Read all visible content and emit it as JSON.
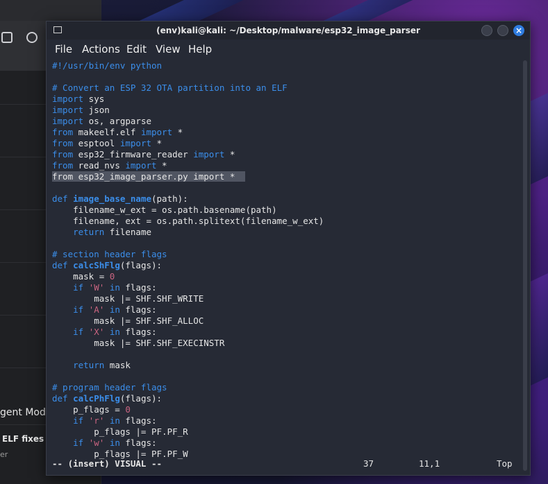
{
  "window": {
    "title": "(env)kali@kali: ~/Desktop/malware/esp32_image_parser"
  },
  "menu": [
    "File",
    "Actions",
    "Edit",
    "View",
    "Help"
  ],
  "bg_app": {
    "mode_label": "gent Mode",
    "item_title": "ELF fixes",
    "item_sub": "er"
  },
  "code": [
    [
      {
        "t": "#!/usr/bin/env python",
        "c": "cm"
      }
    ],
    [],
    [
      {
        "t": "# Convert an ESP 32 OTA partition into an ELF",
        "c": "cm"
      }
    ],
    [
      {
        "t": "import",
        "c": "kw"
      },
      {
        "t": " sys",
        "c": ""
      }
    ],
    [
      {
        "t": "import",
        "c": "kw"
      },
      {
        "t": " json",
        "c": ""
      }
    ],
    [
      {
        "t": "import",
        "c": "kw"
      },
      {
        "t": " os, argparse",
        "c": ""
      }
    ],
    [
      {
        "t": "from",
        "c": "kw"
      },
      {
        "t": " makeelf.elf ",
        "c": ""
      },
      {
        "t": "import",
        "c": "kw"
      },
      {
        "t": " *",
        "c": ""
      }
    ],
    [
      {
        "t": "from",
        "c": "kw"
      },
      {
        "t": " esptool ",
        "c": ""
      },
      {
        "t": "import",
        "c": "kw"
      },
      {
        "t": " *",
        "c": ""
      }
    ],
    [
      {
        "t": "from",
        "c": "kw"
      },
      {
        "t": " esp32_firmware_reader ",
        "c": ""
      },
      {
        "t": "import",
        "c": "kw"
      },
      {
        "t": " *",
        "c": ""
      }
    ],
    [
      {
        "t": "from",
        "c": "kw"
      },
      {
        "t": " read_nvs ",
        "c": ""
      },
      {
        "t": "import",
        "c": "kw"
      },
      {
        "t": " *",
        "c": ""
      }
    ],
    [
      {
        "t": "from esp32_image_parser.py import *  ",
        "c": "hl"
      }
    ],
    [],
    [
      {
        "t": "def",
        "c": "kw"
      },
      {
        "t": " ",
        "c": ""
      },
      {
        "t": "image_base_name",
        "c": "fn"
      },
      {
        "t": "(path):",
        "c": ""
      }
    ],
    [
      {
        "t": "    filename_w_ext = os.path.basename(path)",
        "c": ""
      }
    ],
    [
      {
        "t": "    filename, ext = os.path.splitext(filename_w_ext)",
        "c": ""
      }
    ],
    [
      {
        "t": "    ",
        "c": ""
      },
      {
        "t": "return",
        "c": "kw"
      },
      {
        "t": " filename",
        "c": ""
      }
    ],
    [],
    [
      {
        "t": "# section header flags",
        "c": "cm"
      }
    ],
    [
      {
        "t": "def",
        "c": "kw"
      },
      {
        "t": " ",
        "c": ""
      },
      {
        "t": "calcShFlg",
        "c": "fn"
      },
      {
        "t": "(flags):",
        "c": ""
      }
    ],
    [
      {
        "t": "    mask = ",
        "c": ""
      },
      {
        "t": "0",
        "c": "st"
      }
    ],
    [
      {
        "t": "    ",
        "c": ""
      },
      {
        "t": "if",
        "c": "kw"
      },
      {
        "t": " ",
        "c": ""
      },
      {
        "t": "'W'",
        "c": "st"
      },
      {
        "t": " ",
        "c": ""
      },
      {
        "t": "in",
        "c": "kw"
      },
      {
        "t": " flags:",
        "c": ""
      }
    ],
    [
      {
        "t": "        mask |= SHF.SHF_WRITE",
        "c": ""
      }
    ],
    [
      {
        "t": "    ",
        "c": ""
      },
      {
        "t": "if",
        "c": "kw"
      },
      {
        "t": " ",
        "c": ""
      },
      {
        "t": "'A'",
        "c": "st"
      },
      {
        "t": " ",
        "c": ""
      },
      {
        "t": "in",
        "c": "kw"
      },
      {
        "t": " flags:",
        "c": ""
      }
    ],
    [
      {
        "t": "        mask |= SHF.SHF_ALLOC",
        "c": ""
      }
    ],
    [
      {
        "t": "    ",
        "c": ""
      },
      {
        "t": "if",
        "c": "kw"
      },
      {
        "t": " ",
        "c": ""
      },
      {
        "t": "'X'",
        "c": "st"
      },
      {
        "t": " ",
        "c": ""
      },
      {
        "t": "in",
        "c": "kw"
      },
      {
        "t": " flags:",
        "c": ""
      }
    ],
    [
      {
        "t": "        mask |= SHF.SHF_EXECINSTR",
        "c": ""
      }
    ],
    [],
    [
      {
        "t": "    ",
        "c": ""
      },
      {
        "t": "return",
        "c": "kw"
      },
      {
        "t": " mask",
        "c": ""
      }
    ],
    [],
    [
      {
        "t": "# program header flags",
        "c": "cm"
      }
    ],
    [
      {
        "t": "def",
        "c": "kw"
      },
      {
        "t": " ",
        "c": ""
      },
      {
        "t": "calcPhFlg",
        "c": "fn"
      },
      {
        "t": "(flags):",
        "c": ""
      }
    ],
    [
      {
        "t": "    p_flags = ",
        "c": ""
      },
      {
        "t": "0",
        "c": "st"
      }
    ],
    [
      {
        "t": "    ",
        "c": ""
      },
      {
        "t": "if",
        "c": "kw"
      },
      {
        "t": " ",
        "c": ""
      },
      {
        "t": "'r'",
        "c": "st"
      },
      {
        "t": " ",
        "c": ""
      },
      {
        "t": "in",
        "c": "kw"
      },
      {
        "t": " flags:",
        "c": ""
      }
    ],
    [
      {
        "t": "        p_flags |= PF.PF_R",
        "c": ""
      }
    ],
    [
      {
        "t": "    ",
        "c": ""
      },
      {
        "t": "if",
        "c": "kw"
      },
      {
        "t": " ",
        "c": ""
      },
      {
        "t": "'w'",
        "c": "st"
      },
      {
        "t": " ",
        "c": ""
      },
      {
        "t": "in",
        "c": "kw"
      },
      {
        "t": " flags:",
        "c": ""
      }
    ],
    [
      {
        "t": "        p_flags |= PF.PF_W",
        "c": ""
      }
    ]
  ],
  "status": {
    "mode": "-- (insert) VISUAL --",
    "selected": "37",
    "position": "11,1",
    "scroll": "Top"
  },
  "colors": {
    "keyword": "#3b8eea",
    "string": "#c96480",
    "close_button": "#2f7ce0"
  }
}
